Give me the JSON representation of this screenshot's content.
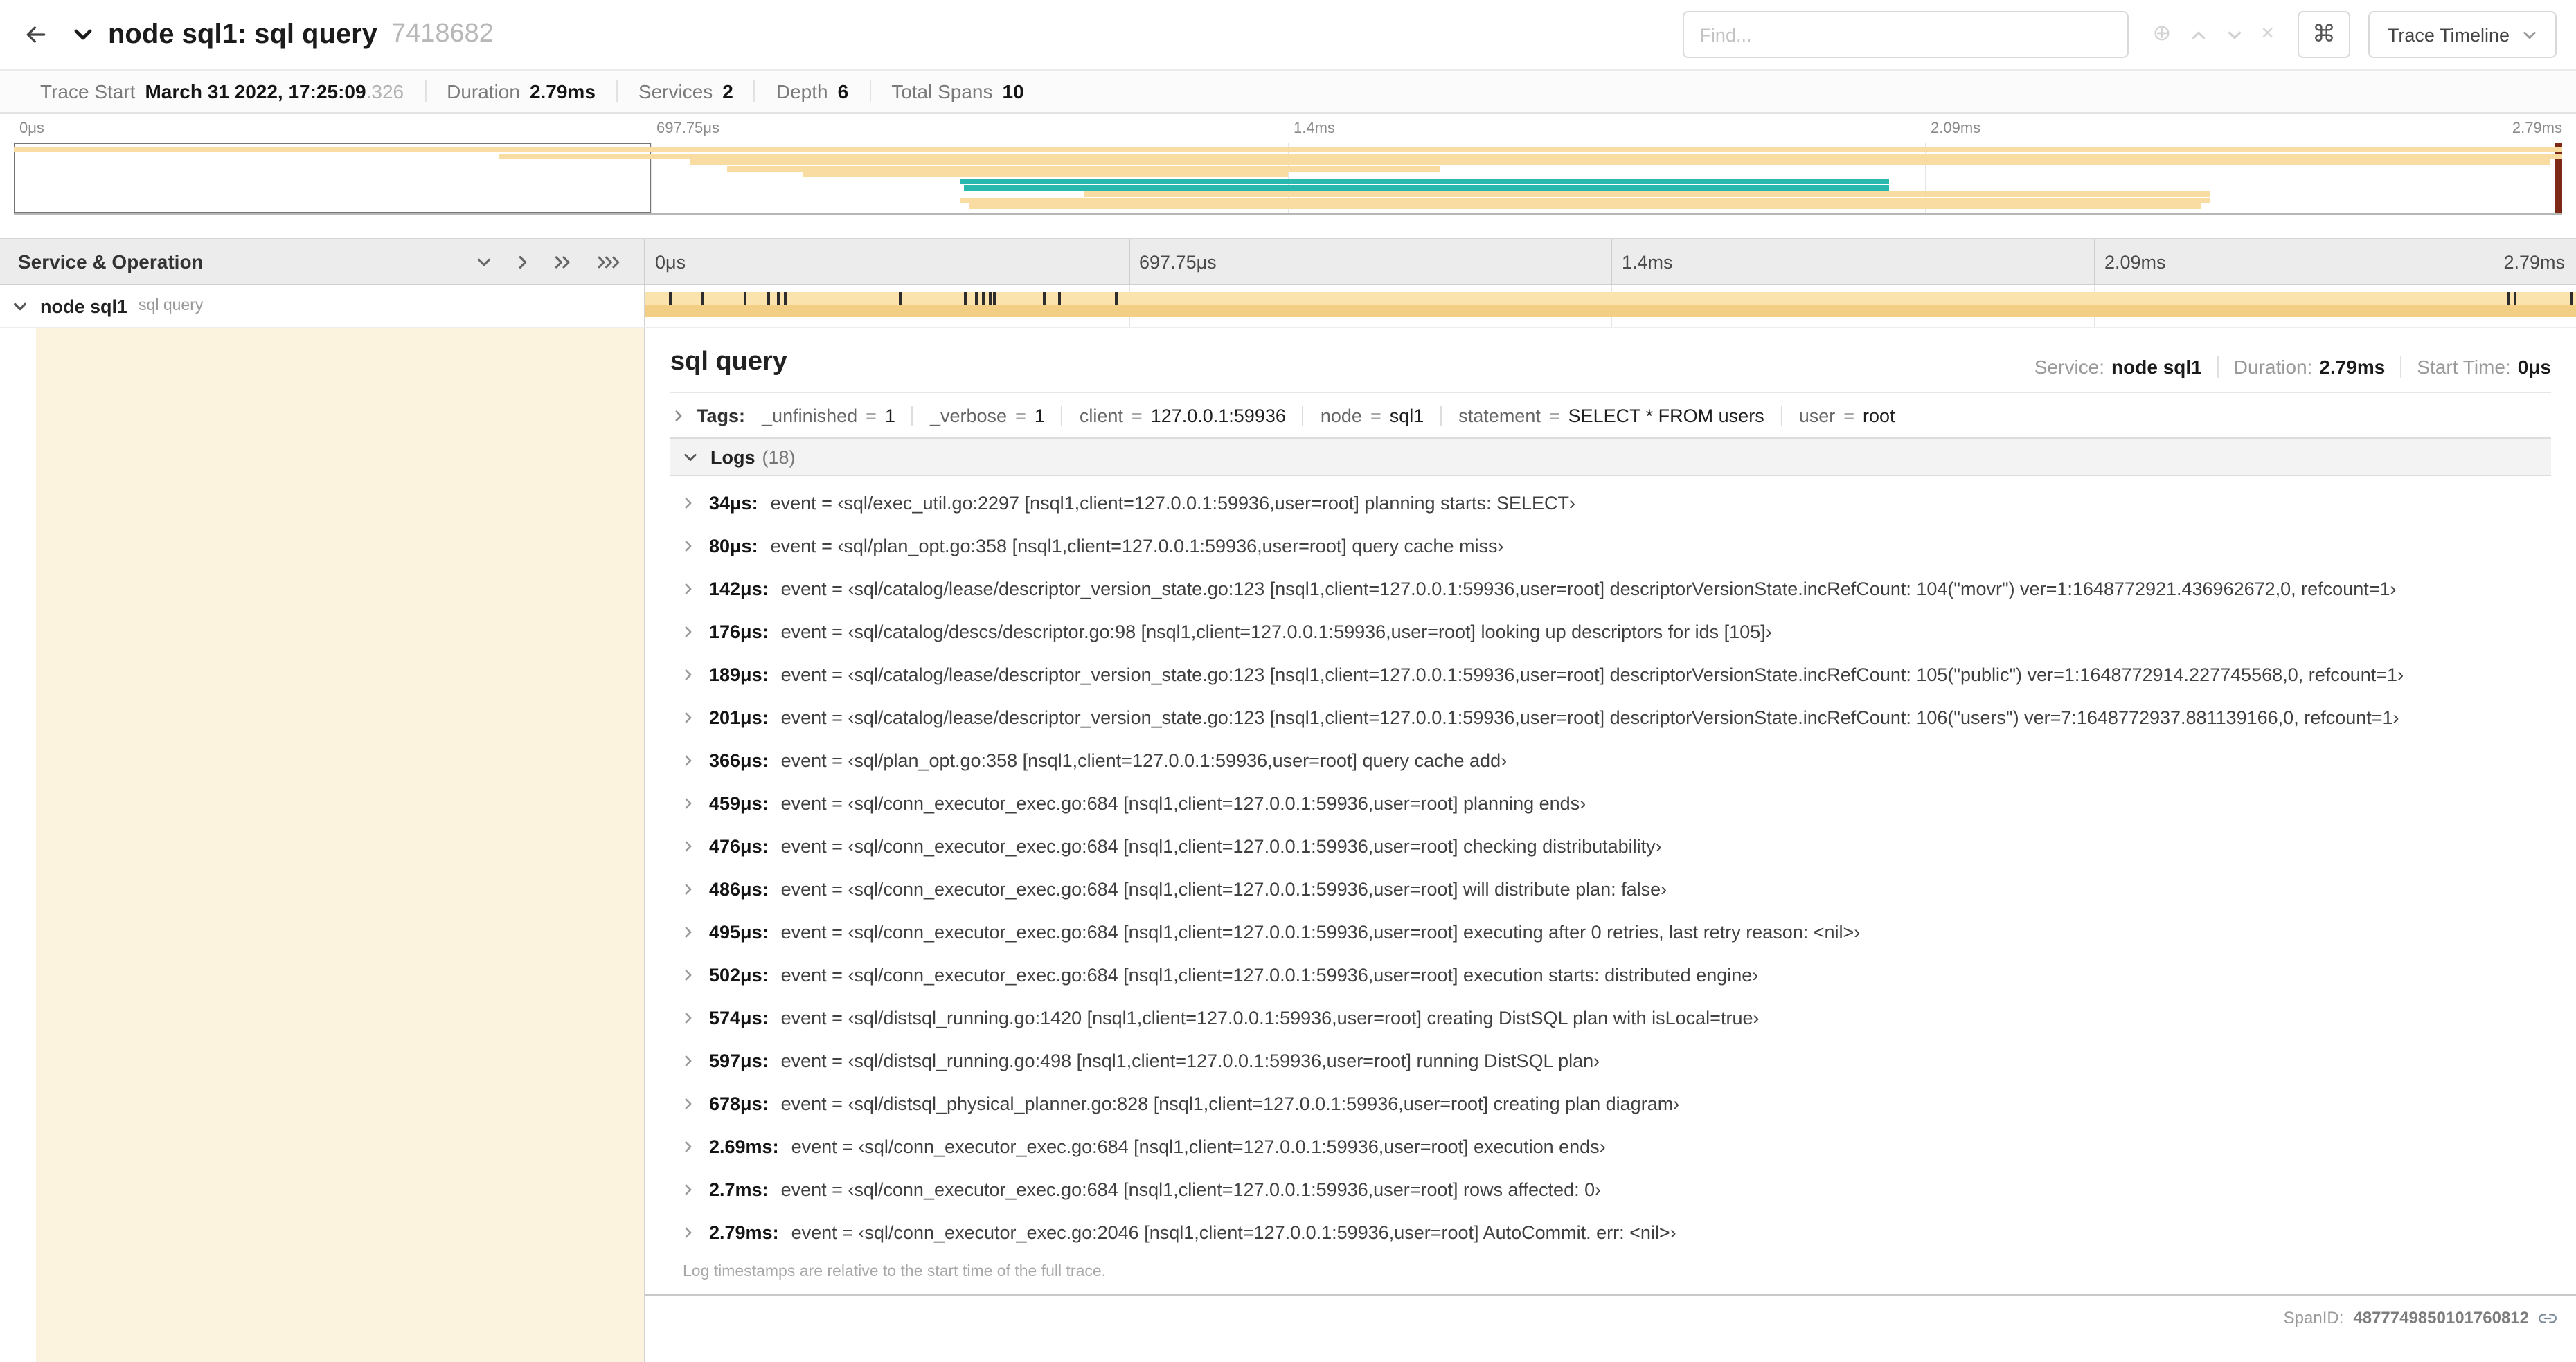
{
  "header": {
    "title": "node sql1: sql query",
    "trace_id": "7418682",
    "find_placeholder": "Find...",
    "shortcut_button": "⌘",
    "view_dropdown": "Trace Timeline"
  },
  "trace_info": {
    "items": [
      {
        "label": "Trace Start",
        "value": "March 31 2022, 17:25:09",
        "value_suffix": ".326"
      },
      {
        "label": "Duration",
        "value": "2.79ms"
      },
      {
        "label": "Services",
        "value": "2"
      },
      {
        "label": "Depth",
        "value": "6"
      },
      {
        "label": "Total Spans",
        "value": "10"
      }
    ]
  },
  "minimap": {
    "ticks": [
      "0μs",
      "697.75μs",
      "1.4ms",
      "2.09ms",
      "2.79ms"
    ],
    "colors": {
      "tan": "#f8dca1",
      "teal": "#29b8ae"
    },
    "bars": [
      {
        "row": 0,
        "start": 0.0,
        "end": 1.0
      },
      {
        "row": 1,
        "start": 0.19,
        "end": 1.0
      },
      {
        "row": 2,
        "start": 0.265,
        "end": 0.995
      },
      {
        "row": 3,
        "start": 0.28,
        "end": 0.56
      },
      {
        "row": 4,
        "start": 0.31,
        "end": 0.5
      },
      {
        "row": 5,
        "start": 0.371,
        "end": 0.736,
        "color": "teal"
      },
      {
        "row": 6,
        "start": 0.373,
        "end": 0.736,
        "color": "teal"
      },
      {
        "row": 7,
        "start": 0.42,
        "end": 0.862
      },
      {
        "row": 8,
        "start": 0.371,
        "end": 0.862
      },
      {
        "row": 9,
        "start": 0.375,
        "end": 0.858
      }
    ]
  },
  "table": {
    "left_header": "Service & Operation",
    "ticks": [
      "0μs",
      "697.75μs",
      "1.4ms",
      "2.09ms",
      "2.79ms"
    ]
  },
  "span_row": {
    "service": "node sql1",
    "operation": "sql query",
    "tick_fracs": [
      0.012,
      0.029,
      0.051,
      0.063,
      0.068,
      0.072,
      0.131,
      0.165,
      0.171,
      0.174,
      0.178,
      0.18,
      0.206,
      0.214,
      0.243,
      0.964,
      0.968,
      0.997
    ]
  },
  "detail": {
    "title": "sql query",
    "service_label": "Service:",
    "service": "node sql1",
    "duration_label": "Duration:",
    "duration": "2.79ms",
    "start_label": "Start Time:",
    "start": "0μs",
    "tags_label": "Tags:",
    "tags": [
      {
        "key": "_unfinished",
        "value": "1"
      },
      {
        "key": "_verbose",
        "value": "1"
      },
      {
        "key": "client",
        "value": "127.0.0.1:59936"
      },
      {
        "key": "node",
        "value": "sql1"
      },
      {
        "key": "statement",
        "value": "SELECT * FROM users"
      },
      {
        "key": "user",
        "value": "root"
      }
    ],
    "logs_label": "Logs",
    "logs_count": "(18)",
    "logs": [
      {
        "time": "34μs:",
        "text": "event = ‹sql/exec_util.go:2297 [nsql1,client=127.0.0.1:59936,user=root] planning starts: SELECT›"
      },
      {
        "time": "80μs:",
        "text": "event = ‹sql/plan_opt.go:358 [nsql1,client=127.0.0.1:59936,user=root] query cache miss›"
      },
      {
        "time": "142μs:",
        "text": "event = ‹sql/catalog/lease/descriptor_version_state.go:123 [nsql1,client=127.0.0.1:59936,user=root] descriptorVersionState.incRefCount: 104(\"movr\") ver=1:1648772921.436962672,0, refcount=1›"
      },
      {
        "time": "176μs:",
        "text": "event = ‹sql/catalog/descs/descriptor.go:98 [nsql1,client=127.0.0.1:59936,user=root] looking up descriptors for ids [105]›"
      },
      {
        "time": "189μs:",
        "text": "event = ‹sql/catalog/lease/descriptor_version_state.go:123 [nsql1,client=127.0.0.1:59936,user=root] descriptorVersionState.incRefCount: 105(\"public\") ver=1:1648772914.227745568,0, refcount=1›"
      },
      {
        "time": "201μs:",
        "text": "event = ‹sql/catalog/lease/descriptor_version_state.go:123 [nsql1,client=127.0.0.1:59936,user=root] descriptorVersionState.incRefCount: 106(\"users\") ver=7:1648772937.881139166,0, refcount=1›"
      },
      {
        "time": "366μs:",
        "text": "event = ‹sql/plan_opt.go:358 [nsql1,client=127.0.0.1:59936,user=root] query cache add›"
      },
      {
        "time": "459μs:",
        "text": "event = ‹sql/conn_executor_exec.go:684 [nsql1,client=127.0.0.1:59936,user=root] planning ends›"
      },
      {
        "time": "476μs:",
        "text": "event = ‹sql/conn_executor_exec.go:684 [nsql1,client=127.0.0.1:59936,user=root] checking distributability›"
      },
      {
        "time": "486μs:",
        "text": "event = ‹sql/conn_executor_exec.go:684 [nsql1,client=127.0.0.1:59936,user=root] will distribute plan: false›"
      },
      {
        "time": "495μs:",
        "text": "event = ‹sql/conn_executor_exec.go:684 [nsql1,client=127.0.0.1:59936,user=root] executing after 0 retries, last retry reason: <nil>›"
      },
      {
        "time": "502μs:",
        "text": "event = ‹sql/conn_executor_exec.go:684 [nsql1,client=127.0.0.1:59936,user=root] execution starts: distributed engine›"
      },
      {
        "time": "574μs:",
        "text": "event = ‹sql/distsql_running.go:1420 [nsql1,client=127.0.0.1:59936,user=root] creating DistSQL plan with isLocal=true›"
      },
      {
        "time": "597μs:",
        "text": "event = ‹sql/distsql_running.go:498 [nsql1,client=127.0.0.1:59936,user=root] running DistSQL plan›"
      },
      {
        "time": "678μs:",
        "text": "event = ‹sql/distsql_physical_planner.go:828 [nsql1,client=127.0.0.1:59936,user=root] creating plan diagram›"
      },
      {
        "time": "2.69ms:",
        "text": "event = ‹sql/conn_executor_exec.go:684 [nsql1,client=127.0.0.1:59936,user=root] execution ends›"
      },
      {
        "time": "2.7ms:",
        "text": "event = ‹sql/conn_executor_exec.go:684 [nsql1,client=127.0.0.1:59936,user=root] rows affected: 0›"
      },
      {
        "time": "2.79ms:",
        "text": "event = ‹sql/conn_executor_exec.go:2046 [nsql1,client=127.0.0.1:59936,user=root] AutoCommit. err: <nil>›"
      }
    ],
    "logs_footnote": "Log timestamps are relative to the start time of the full trace.",
    "span_id_label": "SpanID:",
    "span_id": "4877749850101760812"
  }
}
